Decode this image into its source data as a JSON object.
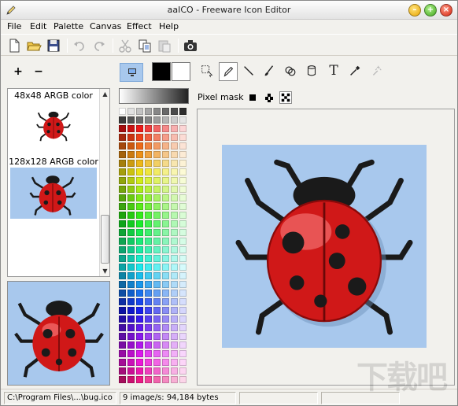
{
  "window": {
    "title": "aaICO - Freeware Icon Editor"
  },
  "menu": {
    "items": [
      {
        "label": "File",
        "accel": "F"
      },
      {
        "label": "Edit",
        "accel": "E"
      },
      {
        "label": "Palette",
        "accel": "P"
      },
      {
        "label": "Canvas",
        "accel": "C"
      },
      {
        "label": "Effect",
        "accel": "f"
      },
      {
        "label": "Help",
        "accel": "H"
      }
    ]
  },
  "toolbar": {
    "icons": [
      "new-icon",
      "open-folder-icon",
      "save-icon",
      "undo-icon",
      "redo-icon",
      "cut-icon",
      "copy-icon",
      "paste-icon",
      "camera-icon"
    ]
  },
  "left_panel": {
    "add_label": "+",
    "remove_label": "−",
    "sizes": [
      {
        "label": "48x48 ARGB color",
        "selected": false
      },
      {
        "label": "128x128 ARGB color",
        "selected": true
      }
    ]
  },
  "palette": {
    "primary_color": "#000000",
    "secondary_color": "#ffffff"
  },
  "tools": {
    "items": [
      "selection-icon",
      "pencil-icon",
      "line-icon",
      "brush-icon",
      "clone-icon",
      "fill-bucket-icon",
      "text-icon",
      "eyedropper-icon",
      "magic-wand-icon"
    ],
    "active": "pencil-icon",
    "text_glyph": "T"
  },
  "pixel_mask": {
    "label": "Pixel mask",
    "options": [
      "solid-mask-icon",
      "pattern-mask-icon",
      "checker-mask-icon"
    ],
    "active": "checker-mask-icon"
  },
  "canvas": {
    "background": "#a8c8ed"
  },
  "statusbar": {
    "path": "C:\\Program Files\\...\\bug.ico",
    "info": "9 image/s: 94,184 bytes"
  },
  "watermark": {
    "text": "下载吧"
  },
  "colors": {
    "selection": "#a8c8ed",
    "bug_red": "#d01818",
    "bug_black": "#1a1a1a"
  }
}
